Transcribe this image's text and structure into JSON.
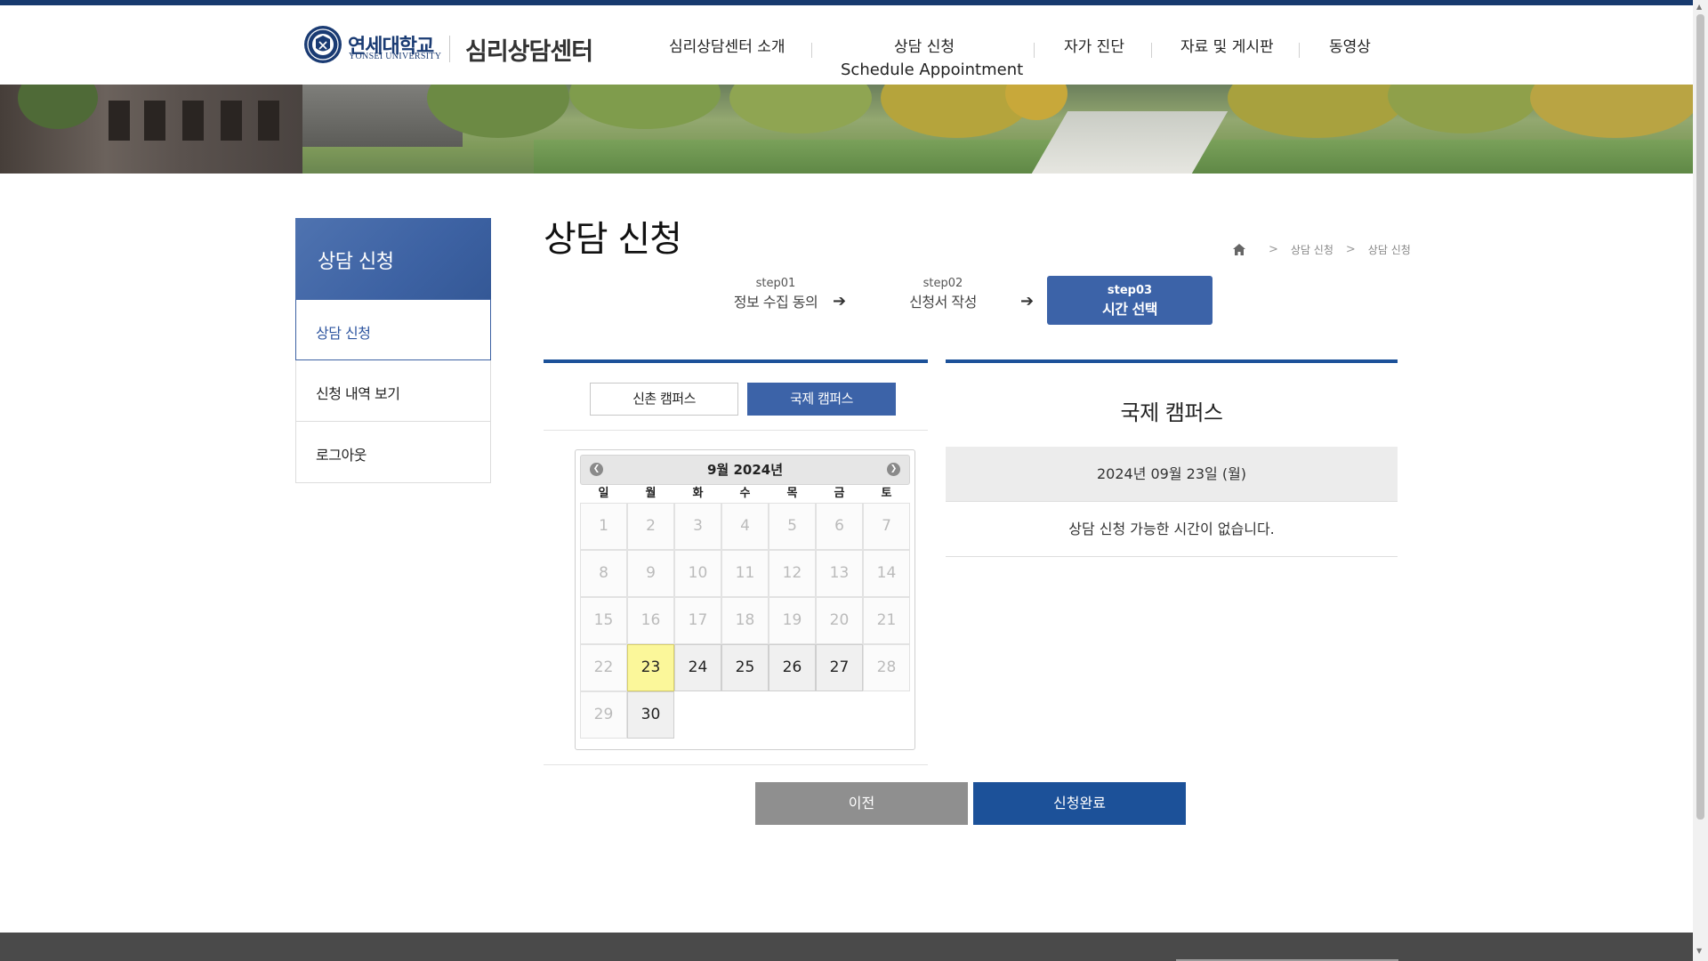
{
  "header": {
    "logo_ko": "연세대학교",
    "logo_en": "YONSEI UNIVERSITY",
    "site_title": "심리상담센터",
    "nav": [
      {
        "label": "심리상담센터 소개",
        "sub": ""
      },
      {
        "label": "상담 신청",
        "sub": "Schedule Appointment"
      },
      {
        "label": "자가 진단",
        "sub": ""
      },
      {
        "label": "자료 및 게시판",
        "sub": ""
      },
      {
        "label": "동영상",
        "sub": ""
      }
    ]
  },
  "sidebar": {
    "title": "상담 신청",
    "items": [
      {
        "label": "상담 신청",
        "active": true
      },
      {
        "label": "신청 내역 보기",
        "active": false
      },
      {
        "label": "로그아웃",
        "active": false
      }
    ]
  },
  "main": {
    "page_title": "상담 신청",
    "breadcrumb": [
      "상담 신청",
      "상담 신청"
    ],
    "steps": [
      {
        "no": "step01",
        "label": "정보 수집 동의"
      },
      {
        "no": "step02",
        "label": "신청서 작성"
      },
      {
        "no": "step03",
        "label": "시간 선택"
      }
    ],
    "step_arrow": "➔",
    "campus_tabs": [
      {
        "label": "신촌 캠퍼스",
        "active": false
      },
      {
        "label": "국제 캠퍼스",
        "active": true
      }
    ],
    "calendar": {
      "title": "9월 2024년",
      "prev": "❮",
      "next": "❯",
      "weekdays": [
        "일",
        "월",
        "화",
        "수",
        "목",
        "금",
        "토"
      ],
      "leading_blanks": 0,
      "days": [
        "1",
        "2",
        "3",
        "4",
        "5",
        "6",
        "7",
        "8",
        "9",
        "10",
        "11",
        "12",
        "13",
        "14",
        "15",
        "16",
        "17",
        "18",
        "19",
        "20",
        "21",
        "22",
        "23",
        "24",
        "25",
        "26",
        "27",
        "28",
        "29",
        "30"
      ],
      "available": [
        "23",
        "24",
        "25",
        "26",
        "27",
        "30"
      ],
      "selected": "23"
    },
    "detail": {
      "campus": "국제 캠퍼스",
      "date": "2024년 09월 23일 (월)",
      "message": "상담 신청 가능한 시간이 없습니다."
    },
    "buttons": {
      "prev": "이전",
      "submit": "신청완료"
    }
  },
  "colors": {
    "primary": "#1c5199",
    "accent": "#3c63a8",
    "selected_day": "#fbf79a",
    "footer": "#4a4a4a"
  }
}
